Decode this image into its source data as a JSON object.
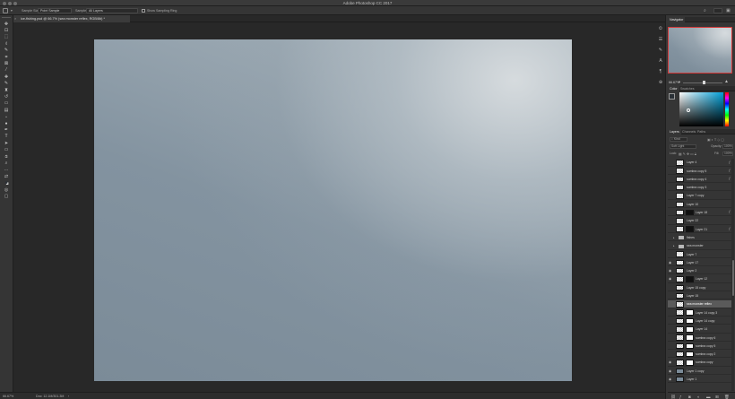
{
  "window": {
    "title": "Adobe Photoshop CC 2017"
  },
  "options_bar": {
    "sample_size_label": "Sample Size:",
    "sample_size_value": "Point Sample",
    "sample_label": "Sample:",
    "sample_value": "All Layers",
    "show_sampling_ring_label": "Show Sampling Ring"
  },
  "document": {
    "tab_label": "ice-fishing.psd @ 66.7% (sea monster reflex, RGB/8#) *",
    "close_glyph": "×",
    "canvas_top_color": "#a9b5bd",
    "canvas_bottom_color": "#7b8b98"
  },
  "status_bar": {
    "zoom": "66.67%",
    "doc_size": "Doc: 12.1M/301.3M"
  },
  "tools": [
    "move",
    "artboard",
    "marquee",
    "lasso",
    "quick-select",
    "crop",
    "frame",
    "eyedropper",
    "spot-heal",
    "brush",
    "clone-stamp",
    "history-brush",
    "eraser",
    "gradient",
    "blur",
    "dodge",
    "pen",
    "type",
    "path-select",
    "rectangle",
    "hand",
    "zoom",
    "more",
    "swap-colors",
    "foreground-color",
    "quick-mask",
    "screen-mode"
  ],
  "navigator": {
    "tab": "Navigator",
    "zoom": "66.67%"
  },
  "color_panel": {
    "tabs": [
      "Color",
      "Swatches"
    ],
    "foreground": "#2a3036",
    "background": "#e8e8e8"
  },
  "layers_panel": {
    "tabs": [
      "Layers",
      "Channels",
      "Paths"
    ],
    "kind_filter": "Kind",
    "blend_mode": "Soft Light",
    "opacity_label": "Opacity:",
    "opacity_value": "100%",
    "lock_label": "Lock:",
    "fill_label": "Fill:",
    "fill_value": "100%",
    "layers": [
      {
        "name": "Layer 4",
        "visible": false,
        "fx": true,
        "mask": false,
        "type": "pixel"
      },
      {
        "name": "sombra copy 5",
        "visible": false,
        "fx": true,
        "mask": false,
        "type": "pixel"
      },
      {
        "name": "sombra copy 4",
        "visible": false,
        "fx": true,
        "mask": false,
        "type": "pixel"
      },
      {
        "name": "sombra copy 3",
        "visible": false,
        "fx": false,
        "mask": false,
        "type": "pixel"
      },
      {
        "name": "Layer 7 copy",
        "visible": false,
        "fx": false,
        "mask": false,
        "type": "pixel"
      },
      {
        "name": "Layer 10",
        "visible": false,
        "fx": false,
        "mask": false,
        "type": "pixel"
      },
      {
        "name": "Layer 18",
        "visible": false,
        "fx": true,
        "mask": true,
        "mask_color": "black",
        "type": "pixel"
      },
      {
        "name": "Layer 22",
        "visible": false,
        "fx": false,
        "mask": false,
        "type": "pixel"
      },
      {
        "name": "Layer 21",
        "visible": false,
        "fx": true,
        "mask": true,
        "mask_color": "black",
        "type": "pixel"
      },
      {
        "name": "fishes",
        "visible": false,
        "fx": false,
        "mask": false,
        "type": "folder"
      },
      {
        "name": "sea monster",
        "visible": false,
        "fx": false,
        "mask": false,
        "type": "folder"
      },
      {
        "name": "Layer 7",
        "visible": false,
        "fx": false,
        "mask": false,
        "type": "pixel"
      },
      {
        "name": "Layer 17",
        "visible": true,
        "fx": false,
        "mask": false,
        "type": "pixel"
      },
      {
        "name": "Layer 2",
        "visible": true,
        "fx": false,
        "mask": false,
        "type": "pixel"
      },
      {
        "name": "Layer 12",
        "visible": true,
        "fx": false,
        "mask": true,
        "mask_color": "black",
        "type": "pixel"
      },
      {
        "name": "Layer 15 copy",
        "visible": false,
        "fx": false,
        "mask": false,
        "type": "pixel"
      },
      {
        "name": "Layer 15",
        "visible": false,
        "fx": false,
        "mask": false,
        "type": "pixel"
      },
      {
        "name": "sea monster reflex",
        "visible": false,
        "fx": false,
        "mask": false,
        "type": "pixel",
        "selected": true
      },
      {
        "name": "Layer 14 copy 3",
        "visible": false,
        "fx": false,
        "mask": true,
        "mask_color": "white",
        "type": "pixel"
      },
      {
        "name": "Layer 14 copy",
        "visible": false,
        "fx": false,
        "mask": true,
        "mask_color": "white",
        "type": "pixel"
      },
      {
        "name": "Layer 14",
        "visible": false,
        "fx": false,
        "mask": true,
        "mask_color": "white",
        "type": "pixel"
      },
      {
        "name": "sombra copy 6",
        "visible": false,
        "fx": false,
        "mask": true,
        "mask_color": "white",
        "type": "pixel"
      },
      {
        "name": "sombra copy 5",
        "visible": false,
        "fx": false,
        "mask": true,
        "mask_color": "white",
        "type": "pixel"
      },
      {
        "name": "sombra copy 2",
        "visible": false,
        "fx": false,
        "mask": true,
        "mask_color": "white",
        "type": "pixel"
      },
      {
        "name": "sombra copy",
        "visible": true,
        "fx": false,
        "mask": true,
        "mask_color": "white",
        "type": "pixel"
      },
      {
        "name": "Layer 1 copy",
        "visible": true,
        "fx": false,
        "mask": false,
        "type": "solid"
      },
      {
        "name": "Layer 1",
        "visible": true,
        "fx": false,
        "mask": false,
        "type": "solid"
      }
    ]
  }
}
